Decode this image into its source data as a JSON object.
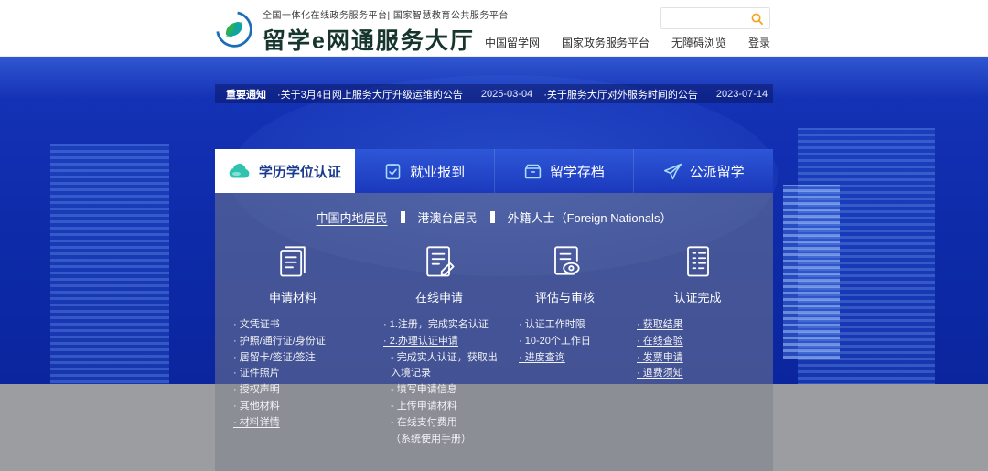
{
  "header": {
    "tagline": "全国一体化在线政务服务平台| 国家智慧教育公共服务平台",
    "title": "留学e网通服务大厅",
    "search_placeholder": "",
    "nav": [
      {
        "label": "中国留学网"
      },
      {
        "label": "国家政务服务平台"
      },
      {
        "label": "无障碍浏览"
      },
      {
        "label": "登录"
      }
    ]
  },
  "notice": {
    "label": "重要通知",
    "items": [
      {
        "title": "·关于3月4日网上服务大厅升级运维的公告",
        "date": "2025-03-04"
      },
      {
        "title": "·关于服务大厅对外服务时间的公告",
        "date": "2023-07-14"
      }
    ]
  },
  "tabs": [
    {
      "label": "学历学位认证",
      "icon": "education-cloud-icon",
      "active": true
    },
    {
      "label": "就业报到",
      "icon": "employment-report-icon",
      "active": false
    },
    {
      "label": "留学存档",
      "icon": "archive-icon",
      "active": false
    },
    {
      "label": "公派留学",
      "icon": "airplane-icon",
      "active": false
    }
  ],
  "panel": {
    "audience": [
      {
        "label": "中国内地居民",
        "active": true
      },
      {
        "label": "港澳台居民",
        "active": false
      },
      {
        "label": "外籍人士（Foreign Nationals）",
        "active": false
      }
    ],
    "columns": [
      {
        "title": "申请材料",
        "icon": "documents-icon",
        "items": [
          "· 文凭证书",
          "· 护照/通行证/身份证",
          "· 居留卡/签证/签注",
          "· 证件照片",
          "· 授权声明",
          "· 其他材料",
          "· 材料详情"
        ]
      },
      {
        "title": "在线申请",
        "icon": "online-apply-icon",
        "items": [
          "· 1.注册，完成实名认证",
          "· 2.办理认证申请",
          "- 完成实人认证，获取出入境记录",
          "- 填写申请信息",
          "- 上传申请材料",
          "- 在线支付费用",
          "（系统使用手册）"
        ]
      },
      {
        "title": "评估与审核",
        "icon": "review-icon",
        "items": [
          "· 认证工作时限",
          "· 10-20个工作日",
          "· 进度查询"
        ]
      },
      {
        "title": "认证完成",
        "icon": "complete-icon",
        "items": [
          "· 获取结果",
          "· 在线查验",
          "· 发票申请",
          "· 退费须知"
        ]
      }
    ]
  }
}
